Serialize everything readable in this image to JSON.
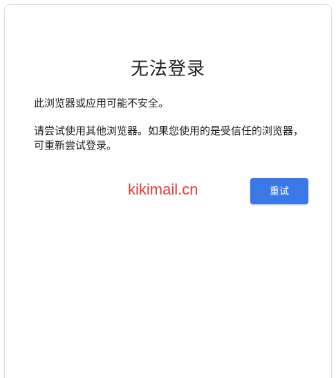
{
  "dialog": {
    "title": "无法登录",
    "message_1": "此浏览器或应用可能不安全。",
    "message_2": "请尝试使用其他浏览器。如果您使用的是受信任的浏览器，可重新尝试登录。",
    "retry_label": "重试"
  },
  "watermark": {
    "text": "kikimail.cn",
    "color": "#e53935"
  },
  "colors": {
    "accent": "#3b78e7",
    "text": "#202124",
    "border": "#dadce0"
  }
}
